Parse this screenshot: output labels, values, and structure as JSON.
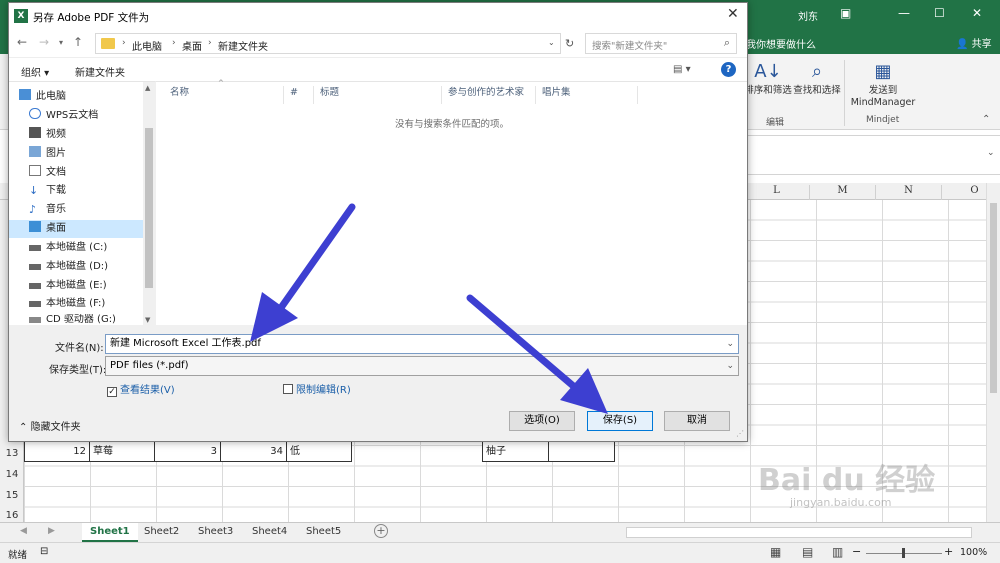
{
  "excel": {
    "user": "刘东",
    "tell_me": "我你想要做什么",
    "share": "共享",
    "ribbon": {
      "sort_filter": "排序和筛选",
      "find_select": "查找和选择",
      "edit_group": "编辑",
      "send_to": "发送到",
      "mindmanager": "MindManager",
      "mindjet_group": "Mindjet"
    },
    "columns": [
      "L",
      "M",
      "N",
      "O"
    ],
    "rows": [
      "13",
      "14",
      "15",
      "16"
    ],
    "row13": {
      "a": "12",
      "b": "草莓",
      "c": "3",
      "d": "34",
      "e": "低",
      "h": "柚子"
    },
    "sheets": [
      "Sheet1",
      "Sheet2",
      "Sheet3",
      "Sheet4",
      "Sheet5"
    ],
    "status_ready": "就绪",
    "zoom": "100%",
    "accent": "#217346"
  },
  "dialog": {
    "title": "另存 Adobe PDF 文件为",
    "breadcrumb": [
      "此电脑",
      "桌面",
      "新建文件夹"
    ],
    "search_placeholder": "搜索\"新建文件夹\"",
    "organize": "组织 ▾",
    "new_folder": "新建文件夹",
    "nav_items": [
      {
        "label": "此电脑",
        "icon": "pc-icon"
      },
      {
        "label": "WPS云文档",
        "icon": "cloud-icon"
      },
      {
        "label": "视频",
        "icon": "video-icon"
      },
      {
        "label": "图片",
        "icon": "image-icon"
      },
      {
        "label": "文档",
        "icon": "document-icon"
      },
      {
        "label": "下载",
        "icon": "download-icon"
      },
      {
        "label": "音乐",
        "icon": "music-icon"
      },
      {
        "label": "桌面",
        "icon": "desktop-icon"
      },
      {
        "label": "本地磁盘 (C:)",
        "icon": "drive-icon"
      },
      {
        "label": "本地磁盘 (D:)",
        "icon": "drive-icon"
      },
      {
        "label": "本地磁盘 (E:)",
        "icon": "drive-icon"
      },
      {
        "label": "本地磁盘 (F:)",
        "icon": "drive-icon"
      },
      {
        "label": "CD 驱动器 (G:)",
        "icon": "cd-icon"
      }
    ],
    "columns": [
      "名称",
      "#",
      "标题",
      "参与创作的艺术家",
      "唱片集"
    ],
    "empty_message": "没有与搜索条件匹配的项。",
    "filename_label": "文件名(N):",
    "filename_value": "新建 Microsoft Excel 工作表.pdf",
    "filetype_label": "保存类型(T):",
    "filetype_value": "PDF files (*.pdf)",
    "view_result": "查看结果(V)",
    "restrict_edit": "限制编辑(R)",
    "hide_folders": "隐藏文件夹",
    "options_button": "选项(O)",
    "save_button": "保存(S)",
    "cancel_button": "取消"
  },
  "watermark": {
    "brand": "Bai du 经验",
    "url": "jingyan.baidu.com"
  },
  "arrow_color": "#3d3fd1"
}
